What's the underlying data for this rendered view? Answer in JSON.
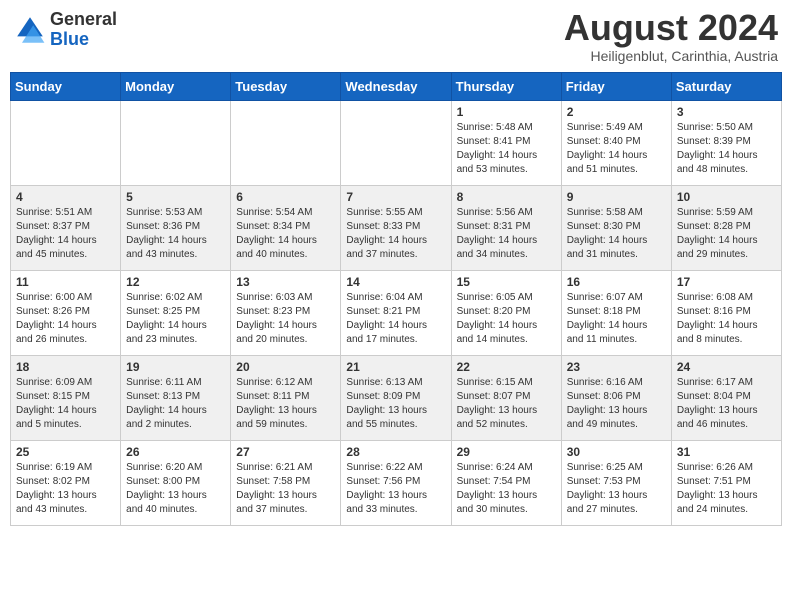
{
  "header": {
    "logo_general": "General",
    "logo_blue": "Blue",
    "month_year": "August 2024",
    "location": "Heiligenblut, Carinthia, Austria"
  },
  "days_of_week": [
    "Sunday",
    "Monday",
    "Tuesday",
    "Wednesday",
    "Thursday",
    "Friday",
    "Saturday"
  ],
  "weeks": [
    [
      {
        "day": "",
        "info": ""
      },
      {
        "day": "",
        "info": ""
      },
      {
        "day": "",
        "info": ""
      },
      {
        "day": "",
        "info": ""
      },
      {
        "day": "1",
        "info": "Sunrise: 5:48 AM\nSunset: 8:41 PM\nDaylight: 14 hours\nand 53 minutes."
      },
      {
        "day": "2",
        "info": "Sunrise: 5:49 AM\nSunset: 8:40 PM\nDaylight: 14 hours\nand 51 minutes."
      },
      {
        "day": "3",
        "info": "Sunrise: 5:50 AM\nSunset: 8:39 PM\nDaylight: 14 hours\nand 48 minutes."
      }
    ],
    [
      {
        "day": "4",
        "info": "Sunrise: 5:51 AM\nSunset: 8:37 PM\nDaylight: 14 hours\nand 45 minutes."
      },
      {
        "day": "5",
        "info": "Sunrise: 5:53 AM\nSunset: 8:36 PM\nDaylight: 14 hours\nand 43 minutes."
      },
      {
        "day": "6",
        "info": "Sunrise: 5:54 AM\nSunset: 8:34 PM\nDaylight: 14 hours\nand 40 minutes."
      },
      {
        "day": "7",
        "info": "Sunrise: 5:55 AM\nSunset: 8:33 PM\nDaylight: 14 hours\nand 37 minutes."
      },
      {
        "day": "8",
        "info": "Sunrise: 5:56 AM\nSunset: 8:31 PM\nDaylight: 14 hours\nand 34 minutes."
      },
      {
        "day": "9",
        "info": "Sunrise: 5:58 AM\nSunset: 8:30 PM\nDaylight: 14 hours\nand 31 minutes."
      },
      {
        "day": "10",
        "info": "Sunrise: 5:59 AM\nSunset: 8:28 PM\nDaylight: 14 hours\nand 29 minutes."
      }
    ],
    [
      {
        "day": "11",
        "info": "Sunrise: 6:00 AM\nSunset: 8:26 PM\nDaylight: 14 hours\nand 26 minutes."
      },
      {
        "day": "12",
        "info": "Sunrise: 6:02 AM\nSunset: 8:25 PM\nDaylight: 14 hours\nand 23 minutes."
      },
      {
        "day": "13",
        "info": "Sunrise: 6:03 AM\nSunset: 8:23 PM\nDaylight: 14 hours\nand 20 minutes."
      },
      {
        "day": "14",
        "info": "Sunrise: 6:04 AM\nSunset: 8:21 PM\nDaylight: 14 hours\nand 17 minutes."
      },
      {
        "day": "15",
        "info": "Sunrise: 6:05 AM\nSunset: 8:20 PM\nDaylight: 14 hours\nand 14 minutes."
      },
      {
        "day": "16",
        "info": "Sunrise: 6:07 AM\nSunset: 8:18 PM\nDaylight: 14 hours\nand 11 minutes."
      },
      {
        "day": "17",
        "info": "Sunrise: 6:08 AM\nSunset: 8:16 PM\nDaylight: 14 hours\nand 8 minutes."
      }
    ],
    [
      {
        "day": "18",
        "info": "Sunrise: 6:09 AM\nSunset: 8:15 PM\nDaylight: 14 hours\nand 5 minutes."
      },
      {
        "day": "19",
        "info": "Sunrise: 6:11 AM\nSunset: 8:13 PM\nDaylight: 14 hours\nand 2 minutes."
      },
      {
        "day": "20",
        "info": "Sunrise: 6:12 AM\nSunset: 8:11 PM\nDaylight: 13 hours\nand 59 minutes."
      },
      {
        "day": "21",
        "info": "Sunrise: 6:13 AM\nSunset: 8:09 PM\nDaylight: 13 hours\nand 55 minutes."
      },
      {
        "day": "22",
        "info": "Sunrise: 6:15 AM\nSunset: 8:07 PM\nDaylight: 13 hours\nand 52 minutes."
      },
      {
        "day": "23",
        "info": "Sunrise: 6:16 AM\nSunset: 8:06 PM\nDaylight: 13 hours\nand 49 minutes."
      },
      {
        "day": "24",
        "info": "Sunrise: 6:17 AM\nSunset: 8:04 PM\nDaylight: 13 hours\nand 46 minutes."
      }
    ],
    [
      {
        "day": "25",
        "info": "Sunrise: 6:19 AM\nSunset: 8:02 PM\nDaylight: 13 hours\nand 43 minutes."
      },
      {
        "day": "26",
        "info": "Sunrise: 6:20 AM\nSunset: 8:00 PM\nDaylight: 13 hours\nand 40 minutes."
      },
      {
        "day": "27",
        "info": "Sunrise: 6:21 AM\nSunset: 7:58 PM\nDaylight: 13 hours\nand 37 minutes."
      },
      {
        "day": "28",
        "info": "Sunrise: 6:22 AM\nSunset: 7:56 PM\nDaylight: 13 hours\nand 33 minutes."
      },
      {
        "day": "29",
        "info": "Sunrise: 6:24 AM\nSunset: 7:54 PM\nDaylight: 13 hours\nand 30 minutes."
      },
      {
        "day": "30",
        "info": "Sunrise: 6:25 AM\nSunset: 7:53 PM\nDaylight: 13 hours\nand 27 minutes."
      },
      {
        "day": "31",
        "info": "Sunrise: 6:26 AM\nSunset: 7:51 PM\nDaylight: 13 hours\nand 24 minutes."
      }
    ]
  ]
}
